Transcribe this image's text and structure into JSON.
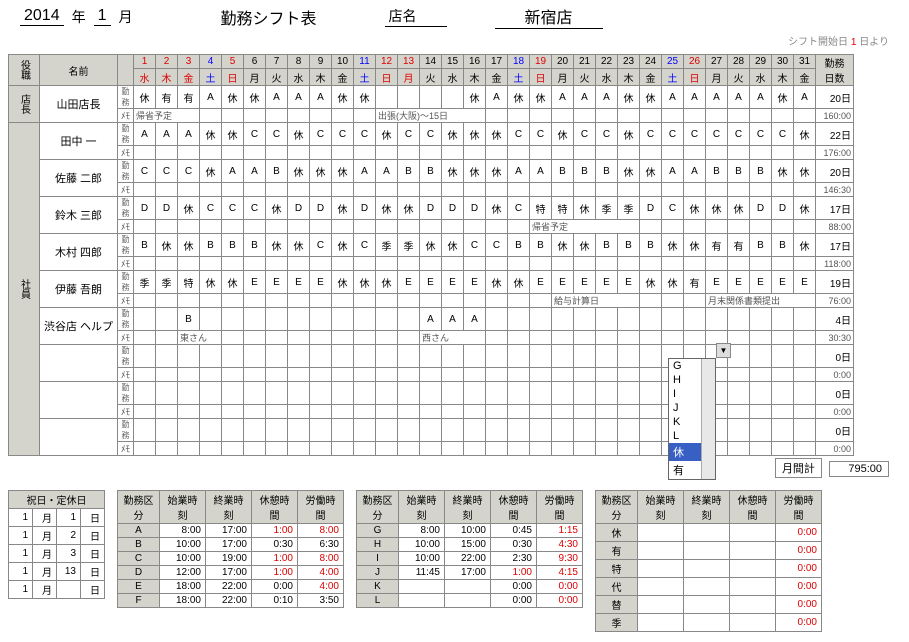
{
  "header": {
    "year": "2014",
    "year_label": "年",
    "month": "1",
    "month_label": "月",
    "title": "勤務シフト表",
    "store_label": "店名",
    "store_name": "新宿店"
  },
  "subheader": {
    "prefix": "シフト開始日",
    "day": "1",
    "suffix": "日より"
  },
  "columns": {
    "role": "役職",
    "name": "名前",
    "small1": "勤務\nﾒﾓ",
    "summary": "勤務\n日数"
  },
  "days": [
    {
      "d": "1",
      "w": "水",
      "c": "sun"
    },
    {
      "d": "2",
      "w": "木",
      "c": "sun"
    },
    {
      "d": "3",
      "w": "金",
      "c": "sun"
    },
    {
      "d": "4",
      "w": "土",
      "c": "sat"
    },
    {
      "d": "5",
      "w": "日",
      "c": "sun"
    },
    {
      "d": "6",
      "w": "月",
      "c": ""
    },
    {
      "d": "7",
      "w": "火",
      "c": ""
    },
    {
      "d": "8",
      "w": "水",
      "c": ""
    },
    {
      "d": "9",
      "w": "木",
      "c": ""
    },
    {
      "d": "10",
      "w": "金",
      "c": ""
    },
    {
      "d": "11",
      "w": "土",
      "c": "sat"
    },
    {
      "d": "12",
      "w": "日",
      "c": "sun"
    },
    {
      "d": "13",
      "w": "月",
      "c": "sun"
    },
    {
      "d": "14",
      "w": "火",
      "c": ""
    },
    {
      "d": "15",
      "w": "水",
      "c": ""
    },
    {
      "d": "16",
      "w": "木",
      "c": ""
    },
    {
      "d": "17",
      "w": "金",
      "c": ""
    },
    {
      "d": "18",
      "w": "土",
      "c": "sat"
    },
    {
      "d": "19",
      "w": "日",
      "c": "sun"
    },
    {
      "d": "20",
      "w": "月",
      "c": ""
    },
    {
      "d": "21",
      "w": "火",
      "c": ""
    },
    {
      "d": "22",
      "w": "水",
      "c": ""
    },
    {
      "d": "23",
      "w": "木",
      "c": ""
    },
    {
      "d": "24",
      "w": "金",
      "c": ""
    },
    {
      "d": "25",
      "w": "土",
      "c": "sat"
    },
    {
      "d": "26",
      "w": "日",
      "c": "sun"
    },
    {
      "d": "27",
      "w": "月",
      "c": ""
    },
    {
      "d": "28",
      "w": "火",
      "c": ""
    },
    {
      "d": "29",
      "w": "水",
      "c": ""
    },
    {
      "d": "30",
      "w": "木",
      "c": ""
    },
    {
      "d": "31",
      "w": "金",
      "c": ""
    }
  ],
  "employees": [
    {
      "role": "店長",
      "name": "山田店長",
      "shifts": [
        "休",
        "有",
        "有",
        "A",
        "休",
        "休",
        "A",
        "A",
        "A",
        "休",
        "休",
        "",
        "",
        "",
        "",
        "休",
        "A",
        "休",
        "休",
        "A",
        "A",
        "A",
        "休",
        "休",
        "A",
        "A",
        "A",
        "A",
        "A",
        "休",
        "A"
      ],
      "days": "20日",
      "hours": "160:00",
      "note": "帰省予定",
      "noteStart": 0,
      "noteEnd": 2,
      "note2": "出張(大阪)～15日",
      "note2Start": 11,
      "note2End": 15
    },
    {
      "role": "社員",
      "name": "田中 一",
      "shifts": [
        "A",
        "A",
        "A",
        "休",
        "休",
        "C",
        "C",
        "休",
        "C",
        "C",
        "C",
        "休",
        "C",
        "C",
        "休",
        "休",
        "休",
        "C",
        "C",
        "休",
        "C",
        "C",
        "休",
        "C",
        "C",
        "C",
        "C",
        "C",
        "C",
        "C",
        "休"
      ],
      "days": "22日",
      "hours": "176:00"
    },
    {
      "role": "",
      "name": "佐藤 二郎",
      "shifts": [
        "C",
        "C",
        "C",
        "休",
        "A",
        "A",
        "B",
        "休",
        "休",
        "休",
        "A",
        "A",
        "B",
        "B",
        "休",
        "休",
        "休",
        "A",
        "A",
        "B",
        "B",
        "B",
        "休",
        "休",
        "A",
        "A",
        "B",
        "B",
        "B",
        "休",
        "休"
      ],
      "days": "20日",
      "hours": "146:30"
    },
    {
      "role": "",
      "name": "鈴木 三郎",
      "shifts": [
        "D",
        "D",
        "休",
        "C",
        "C",
        "C",
        "休",
        "D",
        "D",
        "休",
        "D",
        "休",
        "休",
        "D",
        "D",
        "D",
        "休",
        "C",
        "特",
        "特",
        "休",
        "季",
        "季",
        "D",
        "C",
        "休",
        "休",
        "休",
        "D",
        "D",
        "休"
      ],
      "days": "17日",
      "hours": "88:00",
      "note": "帰省予定",
      "noteStart": 18,
      "noteEnd": 22
    },
    {
      "role": "",
      "name": "木村 四郎",
      "shifts": [
        "B",
        "休",
        "休",
        "B",
        "B",
        "B",
        "休",
        "休",
        "C",
        "休",
        "C",
        "季",
        "季",
        "休",
        "休",
        "C",
        "C",
        "B",
        "B",
        "休",
        "休",
        "B",
        "B",
        "B",
        "休",
        "休",
        "有",
        "有",
        "B",
        "B",
        "休"
      ],
      "days": "17日",
      "hours": "118:00"
    },
    {
      "role": "",
      "name": "伊藤 吾朗",
      "shifts": [
        "季",
        "季",
        "特",
        "休",
        "休",
        "E",
        "E",
        "E",
        "E",
        "休",
        "休",
        "休",
        "E",
        "E",
        "E",
        "E",
        "休",
        "休",
        "E",
        "E",
        "E",
        "E",
        "E",
        "休",
        "休",
        "有",
        "E",
        "E",
        "E",
        "E",
        "E"
      ],
      "days": "19日",
      "hours": "76:00",
      "note": "給与計算日",
      "noteStart": 19,
      "noteEnd": 22,
      "note2": "月末関係書類提出",
      "note2Start": 26,
      "note2End": 30
    },
    {
      "role": "",
      "name": "渋谷店 ヘルプ",
      "shifts": [
        "",
        "",
        "B",
        "",
        "",
        "",
        "",
        "",
        "",
        "",
        "",
        "",
        "",
        "A",
        "A",
        "A",
        "",
        "",
        "",
        "",
        "",
        "",
        "",
        "",
        "",
        "",
        "",
        "",
        "",
        "",
        ""
      ],
      "days": "4日",
      "hours": "30:30",
      "note": "東さん",
      "noteStart": 2,
      "noteEnd": 3,
      "note2": "西さん",
      "note2Start": 13,
      "note2End": 15
    },
    {
      "role": "",
      "name": "",
      "shifts": [
        "",
        "",
        "",
        "",
        "",
        "",
        "",
        "",
        "",
        "",
        "",
        "",
        "",
        "",
        "",
        "",
        "",
        "",
        "",
        "",
        "",
        "",
        "",
        "",
        "",
        "",
        "",
        "",
        "",
        "",
        ""
      ],
      "days": "0日",
      "hours": "0:00"
    },
    {
      "role": "",
      "name": "",
      "shifts": [
        "",
        "",
        "",
        "",
        "",
        "",
        "",
        "",
        "",
        "",
        "",
        "",
        "",
        "",
        "",
        "",
        "",
        "",
        "",
        "",
        "",
        "",
        "",
        "",
        "",
        "",
        "",
        "",
        "",
        "",
        ""
      ],
      "days": "0日",
      "hours": "0:00"
    },
    {
      "role": "",
      "name": "",
      "shifts": [
        "",
        "",
        "",
        "",
        "",
        "",
        "",
        "",
        "",
        "",
        "",
        "",
        "",
        "",
        "",
        "",
        "",
        "",
        "",
        "",
        "",
        "",
        "",
        "",
        "",
        "",
        "",
        "",
        "",
        "",
        ""
      ],
      "days": "0日",
      "hours": "0:00"
    }
  ],
  "monthly_total": {
    "label": "月間計",
    "value": "795:00"
  },
  "dropdown": {
    "items": [
      "G",
      "H",
      "I",
      "J",
      "K",
      "L",
      "休",
      "有"
    ],
    "selected": "休"
  },
  "holidays": {
    "title": "祝日・定休日",
    "rows": [
      {
        "m": "1",
        "ml": "月",
        "d": "1",
        "dl": "日"
      },
      {
        "m": "1",
        "ml": "月",
        "d": "2",
        "dl": "日"
      },
      {
        "m": "1",
        "ml": "月",
        "d": "3",
        "dl": "日"
      },
      {
        "m": "1",
        "ml": "月",
        "d": "13",
        "dl": "日"
      },
      {
        "m": "1",
        "ml": "月",
        "d": "",
        "dl": "日"
      }
    ]
  },
  "shift_defs": {
    "headers": [
      "勤務区分",
      "始業時刻",
      "終業時刻",
      "休憩時間",
      "労働時間"
    ],
    "set1": [
      {
        "code": "A",
        "start": "8:00",
        "end": "17:00",
        "break": "1:00",
        "work": "8:00",
        "r": [
          "break",
          "work"
        ]
      },
      {
        "code": "B",
        "start": "10:00",
        "end": "17:00",
        "break": "0:30",
        "work": "6:30",
        "r": []
      },
      {
        "code": "C",
        "start": "10:00",
        "end": "19:00",
        "break": "1:00",
        "work": "8:00",
        "r": [
          "break",
          "work"
        ]
      },
      {
        "code": "D",
        "start": "12:00",
        "end": "17:00",
        "break": "1:00",
        "work": "4:00",
        "r": [
          "break",
          "work"
        ]
      },
      {
        "code": "E",
        "start": "18:00",
        "end": "22:00",
        "break": "0:00",
        "work": "4:00",
        "r": [
          "work"
        ]
      },
      {
        "code": "F",
        "start": "18:00",
        "end": "22:00",
        "break": "0:10",
        "work": "3:50",
        "r": []
      }
    ],
    "set2": [
      {
        "code": "G",
        "start": "8:00",
        "end": "10:00",
        "break": "0:45",
        "work": "1:15",
        "r": [
          "work"
        ]
      },
      {
        "code": "H",
        "start": "10:00",
        "end": "15:00",
        "break": "0:30",
        "work": "4:30",
        "r": [
          "work"
        ]
      },
      {
        "code": "I",
        "start": "10:00",
        "end": "22:00",
        "break": "2:30",
        "work": "9:30",
        "r": [
          "work"
        ]
      },
      {
        "code": "J",
        "start": "11:45",
        "end": "17:00",
        "break": "1:00",
        "work": "4:15",
        "r": [
          "break",
          "work"
        ]
      },
      {
        "code": "K",
        "start": "",
        "end": "",
        "break": "0:00",
        "work": "0:00",
        "r": [
          "work"
        ]
      },
      {
        "code": "L",
        "start": "",
        "end": "",
        "break": "0:00",
        "work": "0:00",
        "r": [
          "work"
        ]
      }
    ],
    "set3": [
      {
        "code": "休",
        "start": "",
        "end": "",
        "break": "",
        "work": "0:00",
        "r": [
          "work"
        ]
      },
      {
        "code": "有",
        "start": "",
        "end": "",
        "break": "",
        "work": "0:00",
        "r": [
          "work"
        ]
      },
      {
        "code": "特",
        "start": "",
        "end": "",
        "break": "",
        "work": "0:00",
        "r": [
          "work"
        ]
      },
      {
        "code": "代",
        "start": "",
        "end": "",
        "break": "",
        "work": "0:00",
        "r": [
          "work"
        ]
      },
      {
        "code": "替",
        "start": "",
        "end": "",
        "break": "",
        "work": "0:00",
        "r": [
          "work"
        ]
      },
      {
        "code": "季",
        "start": "",
        "end": "",
        "break": "",
        "work": "0:00",
        "r": [
          "work"
        ]
      }
    ]
  }
}
